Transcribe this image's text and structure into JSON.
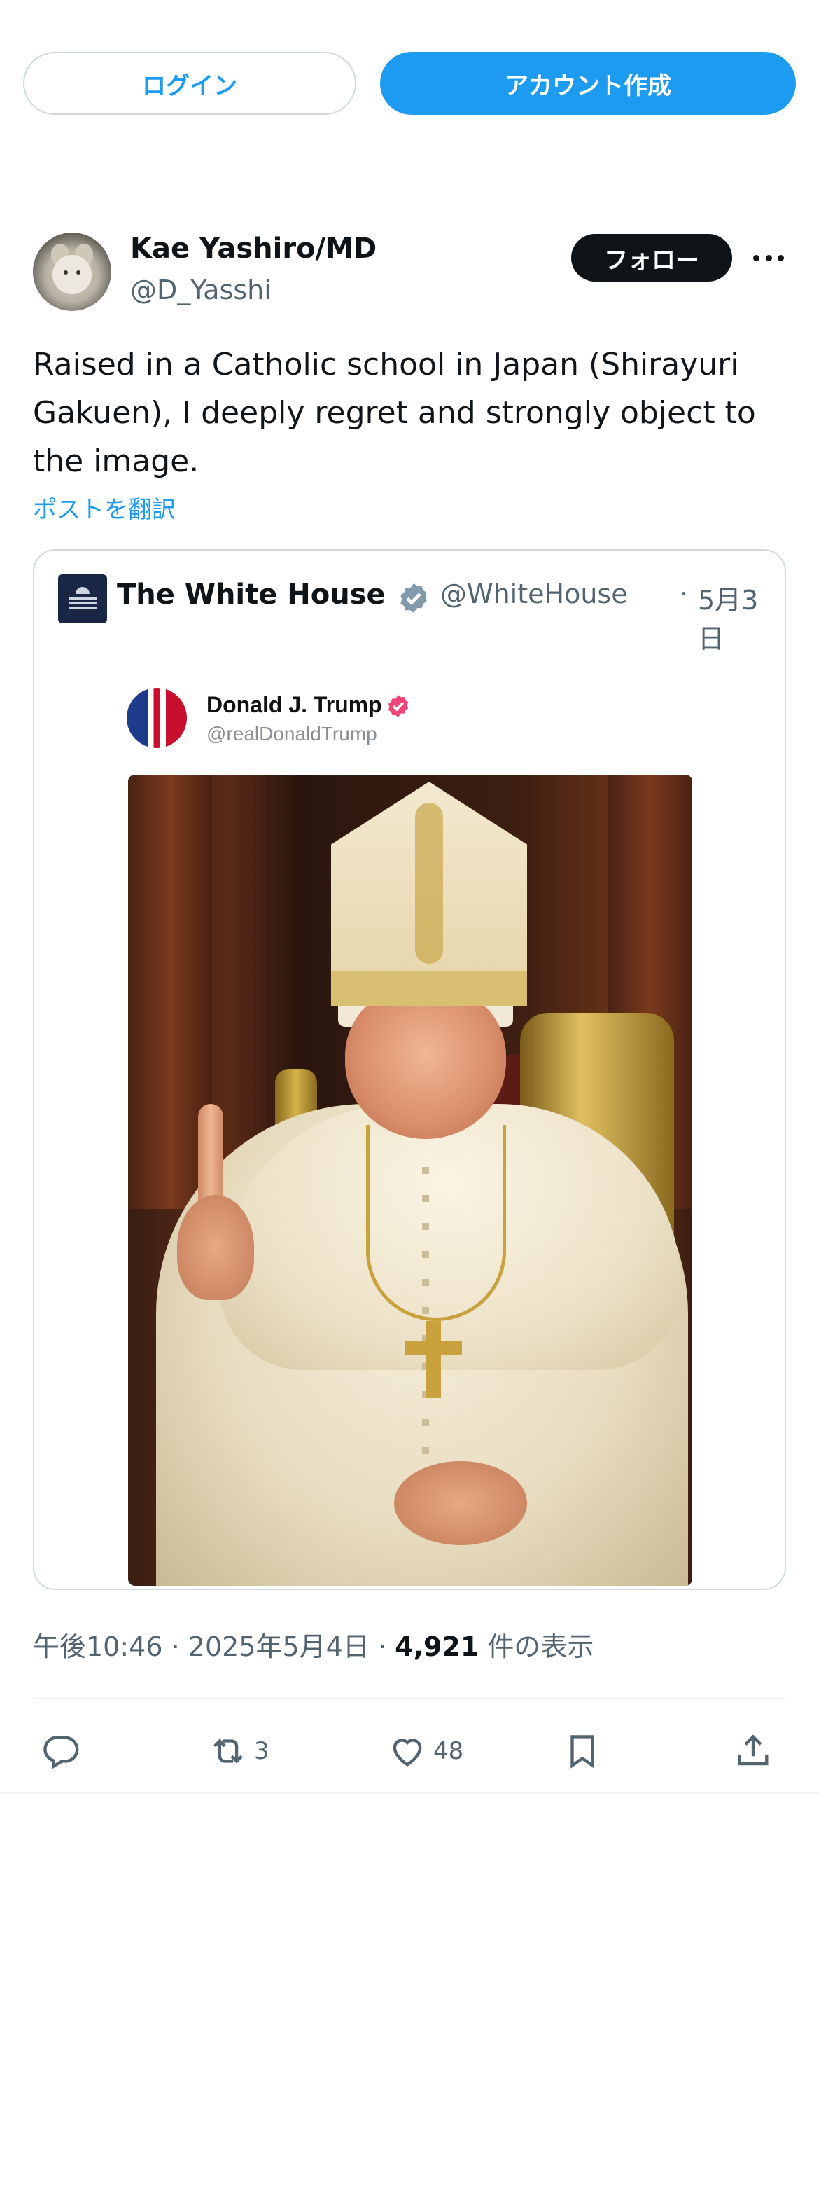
{
  "top_bar": {
    "login_label": "ログイン",
    "signup_label": "アカウント作成"
  },
  "tweet": {
    "author_name": "Kae Yashiro/MD",
    "author_handle": "@D_Yasshi",
    "follow_label": "フォロー",
    "text": "Raised in a Catholic school in Japan (Shirayuri Gakuen), I deeply regret and strongly object to the image.",
    "translate_label": "ポストを翻訳",
    "quote": {
      "name": "The White House",
      "handle": "@WhiteHouse",
      "separator": "·",
      "date": "5月3日",
      "inner_post": {
        "name": "Donald J. Trump",
        "handle": "@realDonaldTrump"
      }
    },
    "meta": {
      "time": "午後10:46",
      "date": "2025年5月4日",
      "views": "4,921",
      "views_label": "件の表示"
    },
    "actions": {
      "reply_count": "",
      "retweet_count": "3",
      "like_count": "48"
    }
  },
  "colors": {
    "accent": "#1d9bf0",
    "text": "#0f1419",
    "muted": "#536471",
    "border": "#cfd9de",
    "verified_gray": "#829aab",
    "badge_pink": "#f1457a"
  }
}
